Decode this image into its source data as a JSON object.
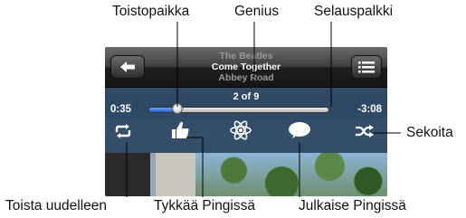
{
  "callouts": {
    "playhead": "Toistopaikka",
    "genius": "Genius",
    "scrubber": "Selauspalkki",
    "shuffle": "Sekoita",
    "repeat": "Toista uudelleen",
    "like": "Tykkää Pingissä",
    "post": "Julkaise Pingissä"
  },
  "now_playing": {
    "artist": "The Beatles",
    "song": "Come Together",
    "album": "Abbey Road",
    "track_position": "2 of 9",
    "elapsed": "0:35",
    "remaining": "-3:08",
    "progress_fraction": 0.16
  },
  "icons": {
    "back": "back-arrow-icon",
    "list": "track-list-icon",
    "repeat": "repeat-icon",
    "like": "thumbs-up-icon",
    "genius": "genius-atom-icon",
    "post": "speech-bubble-icon",
    "shuffle": "shuffle-icon"
  },
  "colors": {
    "scrubber_fill": "#2b6fe0",
    "navbar": "#2a2a2a"
  }
}
